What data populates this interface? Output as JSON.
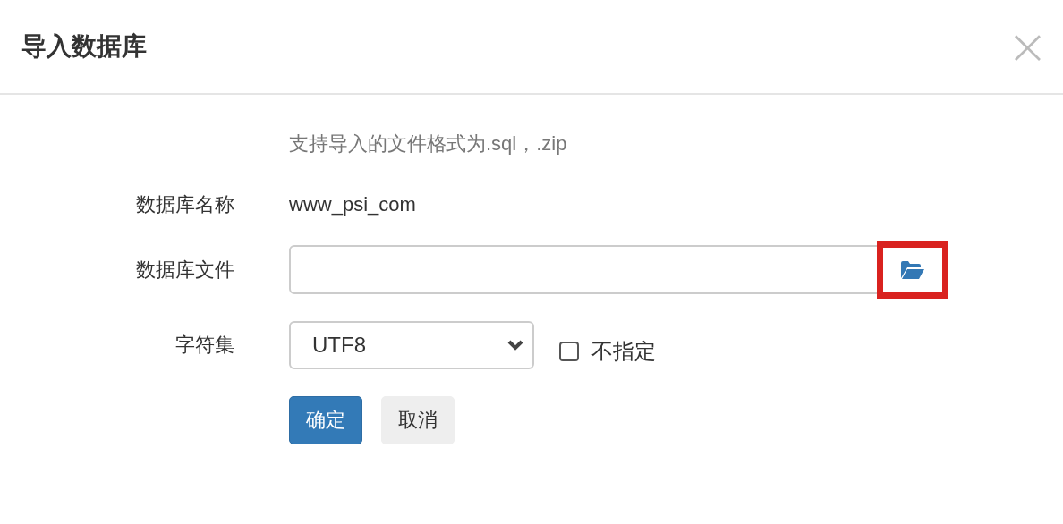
{
  "dialog": {
    "title": "导入数据库",
    "close": "×"
  },
  "hint": "支持导入的文件格式为.sql，.zip",
  "fields": [
    {
      "kind": "text",
      "label": "数据库名称",
      "value": "www_psi_com"
    },
    {
      "kind": "file",
      "label": "数据库文件",
      "highlighted": true
    },
    {
      "kind": "select",
      "label": "字符集",
      "value": "UTF8",
      "checkbox": {
        "label": "不指定",
        "checked": false
      }
    }
  ],
  "buttons": [
    {
      "label": "确定",
      "primary": true
    },
    {
      "label": "取消",
      "primary": false
    }
  ]
}
